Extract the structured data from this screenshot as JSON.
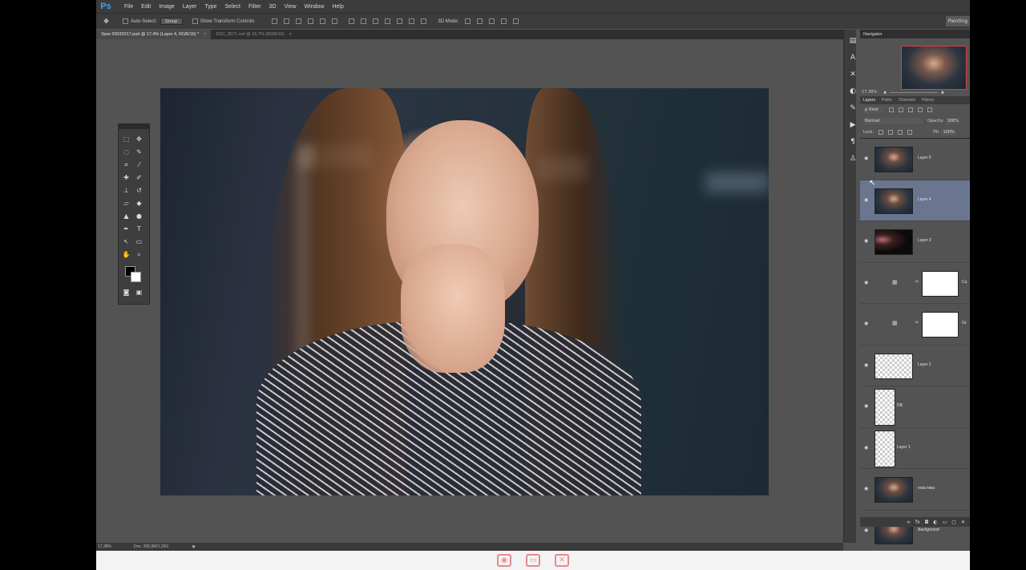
{
  "app": {
    "logo": "Ps"
  },
  "menu": [
    "File",
    "Edit",
    "Image",
    "Layer",
    "Type",
    "Select",
    "Filter",
    "3D",
    "View",
    "Window",
    "Help"
  ],
  "options": {
    "auto_select_label": "Auto-Select:",
    "auto_select_value": "Group",
    "show_transform_label": "Show Transform Controls",
    "mode_label": "3D Mode:",
    "workspace": "Painting"
  },
  "tabs": [
    {
      "label": "Урок 30032017.psd @ 17,4% (Layer 4, RGB/16) *",
      "close": "×"
    },
    {
      "label": "DSC_8571.nef @ 16,7% (RGB/16)",
      "close": "×"
    }
  ],
  "status": {
    "zoom": "17,38%",
    "doc": "Doc: 206,9M/1,33G"
  },
  "dock": {
    "icons": [
      "history-icon",
      "character-icon",
      "tools-preset-icon",
      "adjust-icon",
      "brush-icon",
      "play-icon",
      "paragraph-icon",
      "clone-icon"
    ]
  },
  "navigator": {
    "tab": "Navigator",
    "zoom": "17,38%"
  },
  "layer_panel": {
    "tabs": [
      "Layers",
      "Paths",
      "Channels",
      "History"
    ],
    "kind": "Kind",
    "mode": "Normal",
    "opacity_label": "Opacity:",
    "opacity": "100%",
    "lock_label": "Lock:",
    "fill_label": "Fill:",
    "fill": "100%"
  },
  "layers": [
    {
      "name": "Layer 5",
      "thumb": "portrait",
      "selected": false
    },
    {
      "name": "Layer 4",
      "thumb": "portrait",
      "selected": true
    },
    {
      "name": "Layer 3",
      "thumb": "dark",
      "selected": false
    },
    {
      "name": "Cu",
      "thumb": "adjust-white",
      "selected": false
    },
    {
      "name": "Gr",
      "thumb": "adjust-white",
      "selected": false
    },
    {
      "name": "Layer 2",
      "thumb": "check",
      "selected": false
    },
    {
      "name": "DB",
      "thumb": "tall-check",
      "selected": false
    },
    {
      "name": "Layer 1",
      "thumb": "tall-check",
      "selected": false
    },
    {
      "name": "пластика",
      "thumb": "portrait",
      "selected": false
    },
    {
      "name": "Background",
      "thumb": "portrait",
      "selected": false
    }
  ],
  "colors": {
    "accent": "#3aa5f5",
    "selection": "#6a7690",
    "panel": "#535353",
    "chrome": "#3c3c3c",
    "nav_frame": "#e04040",
    "strip_icon": "#e98a8a"
  }
}
